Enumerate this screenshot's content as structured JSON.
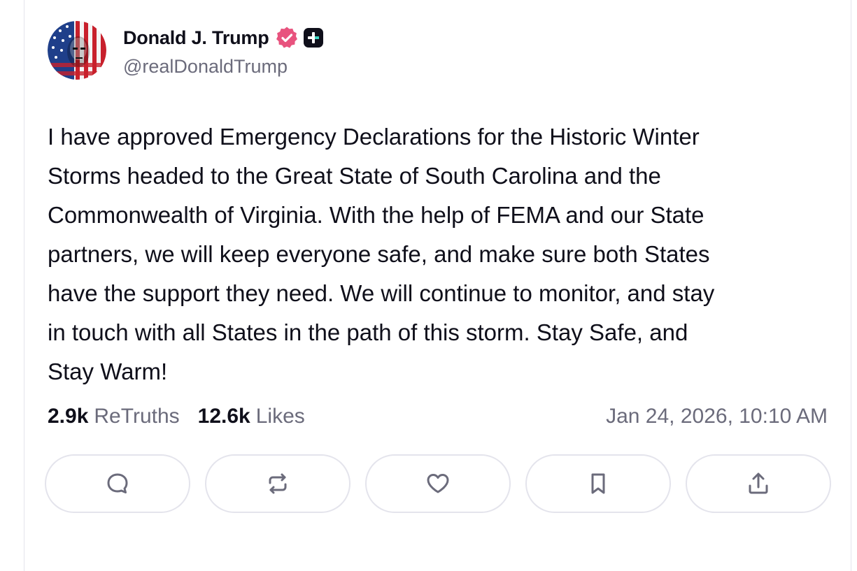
{
  "post": {
    "author": {
      "display_name": "Donald J. Trump",
      "handle": "@realDonaldTrump",
      "avatar_icon": "flag-portrait-avatar",
      "verified_icon": "verified-badge-icon",
      "verified_color": "#e8537e",
      "plus_icon": "truth-plus-icon"
    },
    "body_lines": [
      "I have approved Emergency Declarations for the Historic Winter",
      "Storms headed to the Great State of South Carolina and the",
      "Commonwealth of Virginia. With the help of FEMA and our State",
      "partners, we will keep everyone safe, and make sure both States",
      "have the support they need. We will continue to monitor, and stay",
      "in touch with all States in the path of this storm. Stay Safe, and",
      "Stay Warm!"
    ],
    "stats": {
      "retruths_count": "2.9k",
      "retruths_label": "ReTruths",
      "likes_count": "12.6k",
      "likes_label": "Likes"
    },
    "timestamp": "Jan 24, 2026, 10:10 AM",
    "actions": [
      {
        "name": "reply",
        "icon": "comment-icon"
      },
      {
        "name": "retruth",
        "icon": "repost-icon"
      },
      {
        "name": "like",
        "icon": "heart-icon"
      },
      {
        "name": "bookmark",
        "icon": "bookmark-icon"
      },
      {
        "name": "share",
        "icon": "share-icon"
      }
    ]
  },
  "colors": {
    "text_primary": "#0f0f1a",
    "text_secondary": "#6b6b7b",
    "border": "#e4e4ec",
    "icon": "#6b6b7b"
  }
}
